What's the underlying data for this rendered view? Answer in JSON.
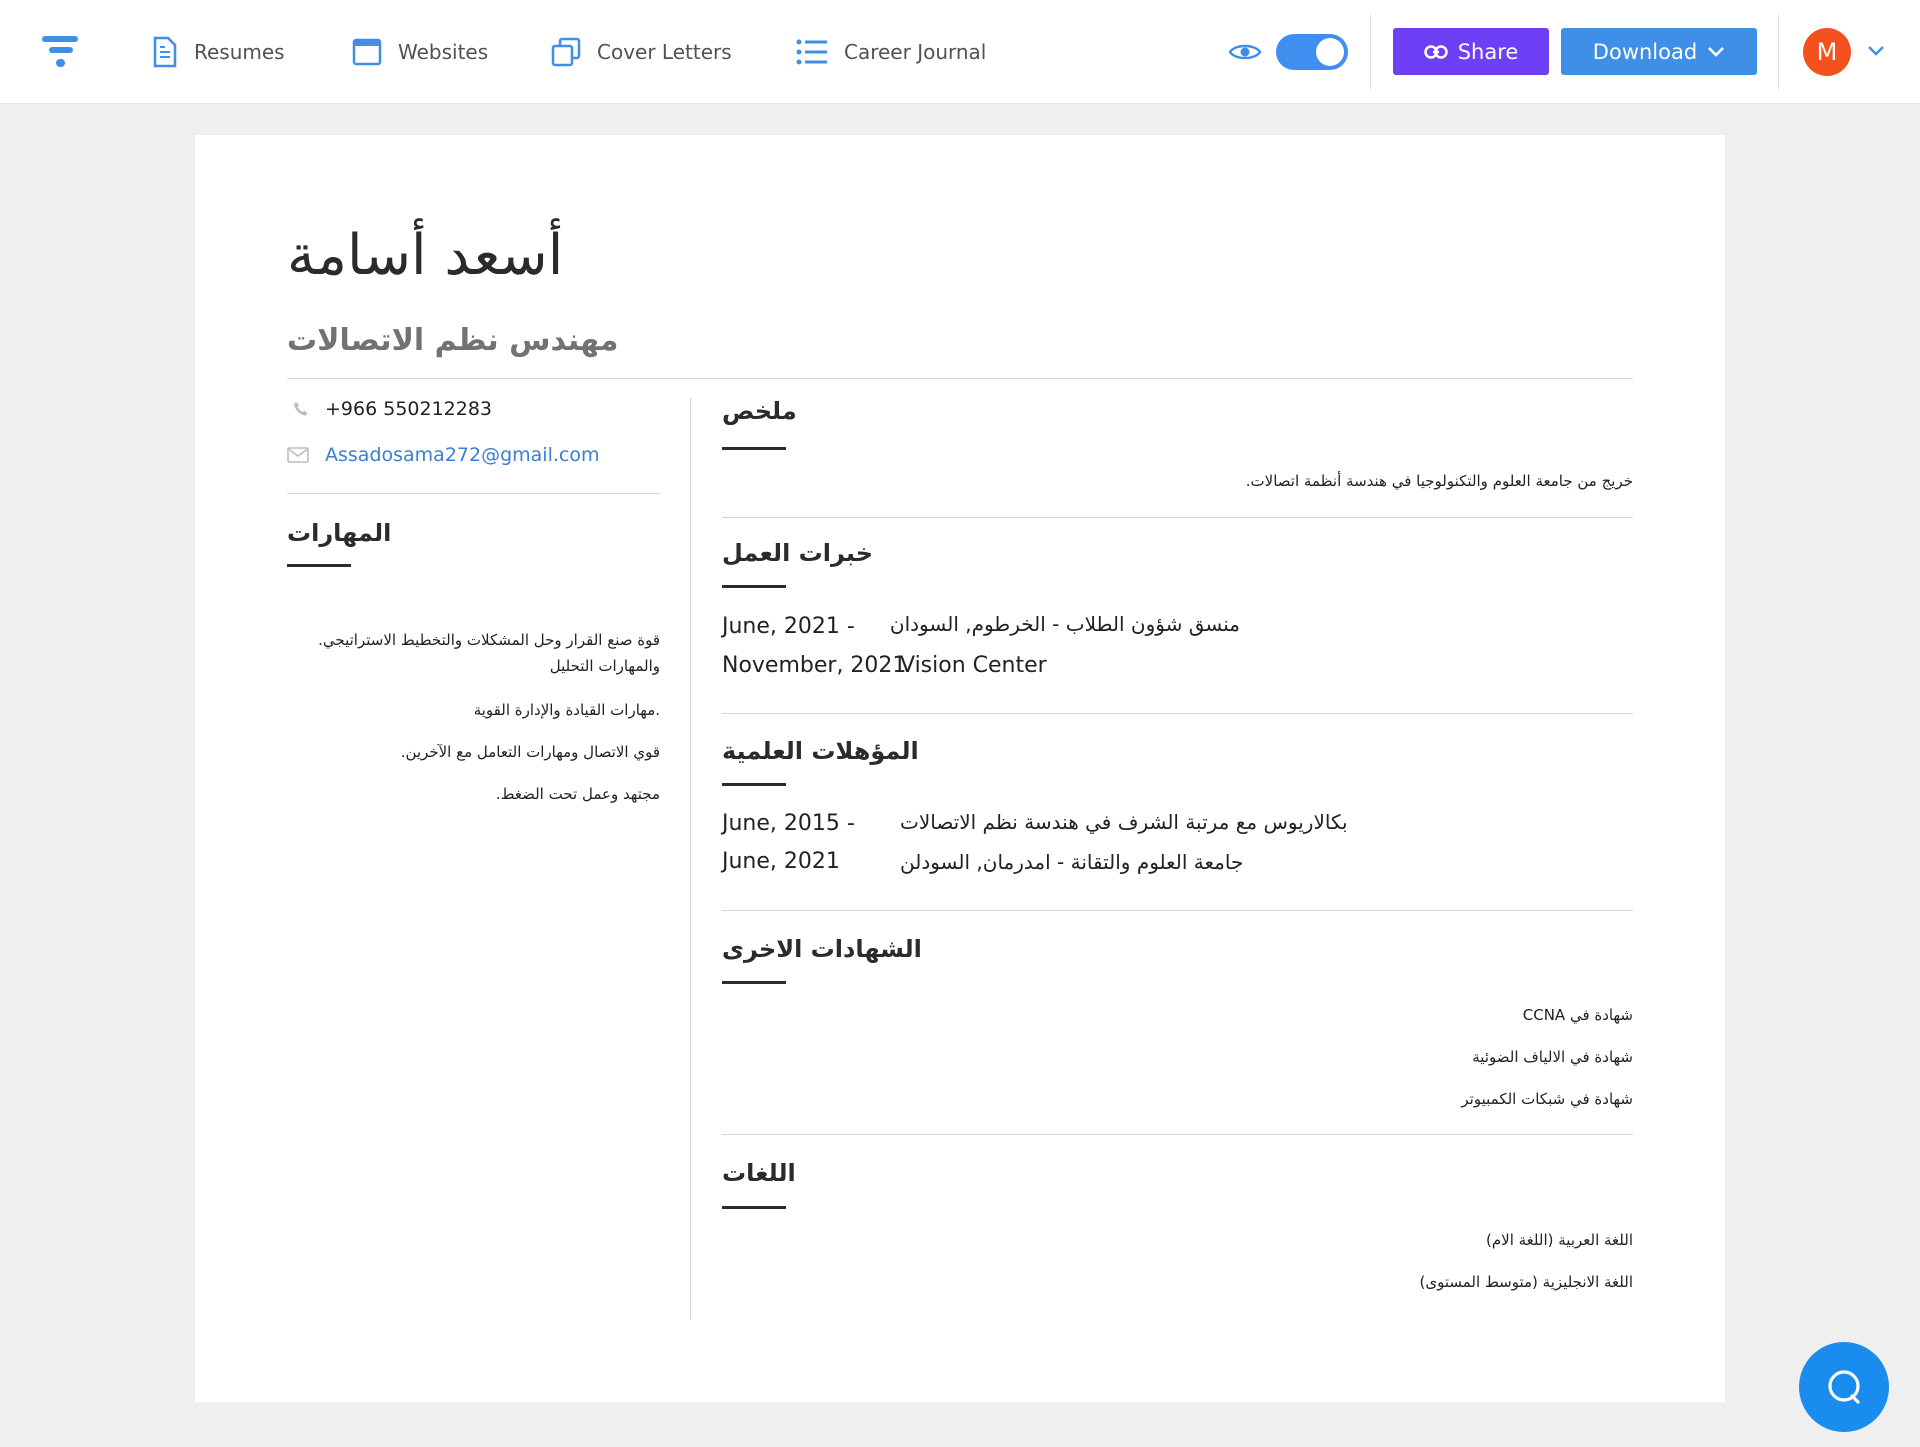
{
  "nav": {
    "items": [
      {
        "label": "Resumes",
        "icon": "document-icon"
      },
      {
        "label": "Websites",
        "icon": "browser-window-icon"
      },
      {
        "label": "Cover Letters",
        "icon": "copy-pages-icon"
      },
      {
        "label": "Career Journal",
        "icon": "list-icon"
      }
    ],
    "share_label": "Share",
    "download_label": "Download",
    "avatar_initial": "M",
    "colors": {
      "share": "#6e3ff5",
      "download": "#3f8ee8",
      "toggle": "#3f8ef0",
      "avatar": "#f4511e"
    }
  },
  "resume": {
    "name": "أسعد أسامة",
    "title": "مهندس نظم الاتصالات",
    "phone": "+966 550212283",
    "email": "Assadosama272@gmail.com",
    "skills": {
      "heading": "المهارات",
      "items": [
        "قوة صنع القرار وحل المشكلات والتخطيط الاستراتيجي. والمهارات التحليل",
        ".مهارات القيادة والإدارة القوية",
        "قوي الاتصال ومهارات التعامل مع الآخرين.",
        "مجتهد وعمل تحت الضغط."
      ]
    },
    "summary": {
      "heading": "ملخص",
      "text": "خريج من جامعة العلوم والتكنولوجيا في هندسة أنظمة اتصالات."
    },
    "experience": {
      "heading": "خبرات العمل",
      "date_start": "June, 2021 -",
      "date_end": "November, 2021",
      "role": "منسق شؤون الطلاب - الخرطوم, السودان",
      "company": "Vision Center"
    },
    "education": {
      "heading": "المؤهلات العلمية",
      "date_start": "June, 2015 -",
      "date_end": "June, 2021",
      "degree": "بكالاريوس مع مرتبة الشرف في هندسة نظم الاتصالات",
      "school": "جامعة العلوم والتقانة - امدرمان, السودلن"
    },
    "certificates": {
      "heading": "الشهادات الاخرى",
      "items": [
        "شهادة في CCNA",
        "شهادة في الالياف الضوئية",
        "شهادة في شبكات الكمبيوتر"
      ]
    },
    "languages": {
      "heading": "اللغات",
      "items": [
        "اللغة العربية (اللغة الام)",
        "اللغة الانجليزية (متوسط المستوى)"
      ]
    }
  }
}
